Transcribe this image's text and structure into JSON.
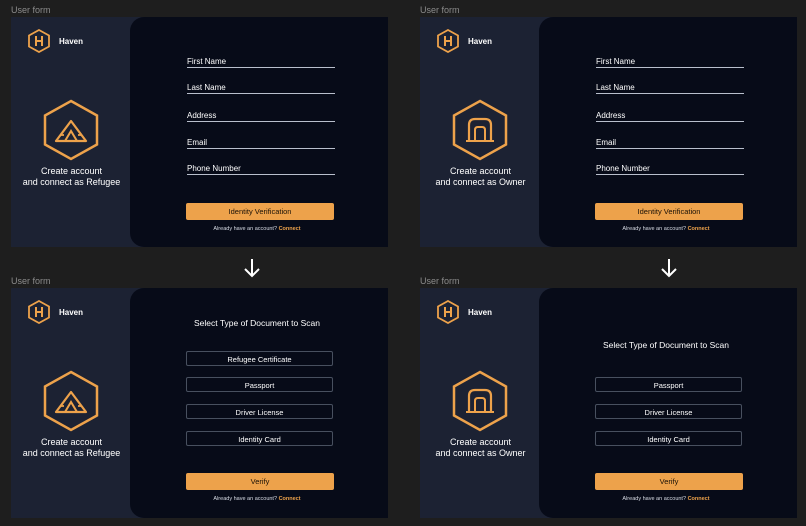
{
  "frame_label": "User form",
  "brand": {
    "name": "Haven"
  },
  "refugee": {
    "caption_line1": "Create account",
    "caption_line2": "and connect as Refugee"
  },
  "owner": {
    "caption_line1": "Create account",
    "caption_line2": "and connect as Owner"
  },
  "form": {
    "fields": [
      "First Name",
      "Last Name",
      "Address",
      "Email",
      "Phone Number"
    ],
    "submit_label": "Identity Verification"
  },
  "footer": {
    "text": "Already have an account?",
    "link": "Connect"
  },
  "scan": {
    "title": "Select Type of Document to Scan",
    "refugee_options": [
      "Refugee Certificate",
      "Passport",
      "Driver License",
      "Identity Card"
    ],
    "owner_options": [
      "Passport",
      "Driver License",
      "Identity Card"
    ],
    "verify_label": "Verify"
  },
  "colors": {
    "accent": "#eda24b",
    "panel": "#070b18",
    "sidebar": "#1c2233",
    "canvas": "#1e1e1e"
  }
}
